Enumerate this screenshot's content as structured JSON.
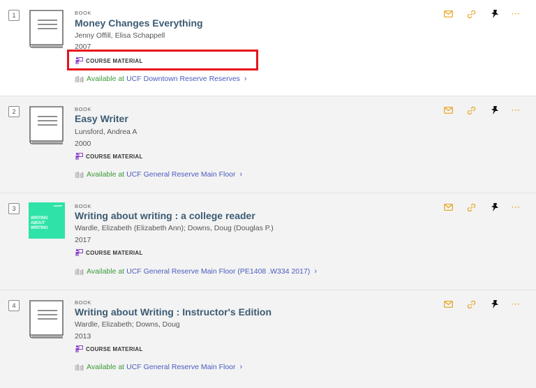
{
  "records": [
    {
      "number": "1",
      "type": "BOOK",
      "title": "Money Changes Everything",
      "authors": "Jenny Offill, Elisa Schappell",
      "year": "2007",
      "course_label": "COURSE MATERIAL",
      "availability_status": "Available at",
      "availability_location": "UCF Downtown Reserve  Reserves",
      "cover": "book-placeholder-icon"
    },
    {
      "number": "2",
      "type": "BOOK",
      "title": "Easy Writer",
      "authors": "Lunsford, Andrea A",
      "year": "2000",
      "course_label": "COURSE MATERIAL",
      "availability_status": "Available at",
      "availability_location": "UCF General Reserve  Main Floor",
      "cover": "book-placeholder-icon"
    },
    {
      "number": "3",
      "type": "BOOK",
      "title": "Writing about writing : a college reader",
      "authors": "Wardle, Elizabeth (Elizabeth Ann); Downs, Doug (Douglas P.)",
      "year": "2017",
      "course_label": "COURSE MATERIAL",
      "availability_status": "Available at",
      "availability_location": "UCF General Reserve  Main Floor (PE1408 .W334 2017)",
      "cover": "cover-image",
      "cover_text": [
        "WRITING",
        "ABOUT",
        "WRITING"
      ]
    },
    {
      "number": "4",
      "type": "BOOK",
      "title": "Writing about Writing : Instructor's Edition",
      "authors": "Wardle, Elizabeth; Downs, Doug",
      "year": "2013",
      "course_label": "COURSE MATERIAL",
      "availability_status": "Available at",
      "availability_location": "UCF General Reserve  Main Floor",
      "cover": "book-placeholder-icon"
    }
  ],
  "actions": {
    "more_label": "···"
  },
  "colors": {
    "title": "#3b5b73",
    "available": "#3a9a3a",
    "location_link": "#4a5bbf",
    "action_icons": "#e6a31b",
    "course_icon": "#8a3fc7",
    "highlight": "#e8141c"
  }
}
